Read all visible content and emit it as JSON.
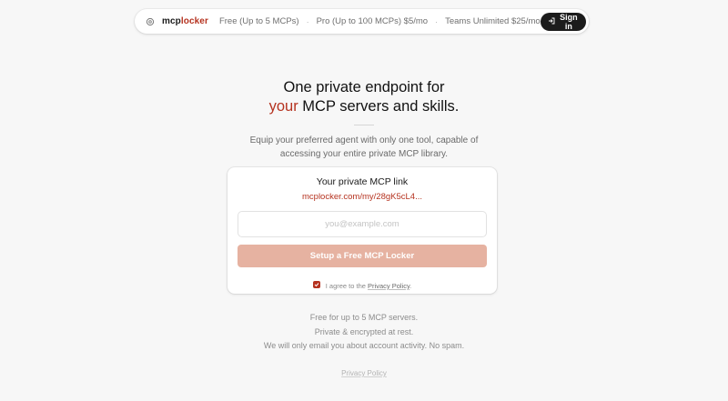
{
  "nav": {
    "logo_mcp": "mcp",
    "logo_locker": "locker",
    "tiers": [
      "Free (Up to 5 MCPs)",
      "Pro (Up to 100 MCPs) $5/mo",
      "Teams Unlimited $25/mo"
    ],
    "signin_label": "Sign in",
    "signin_icon": "login-icon",
    "logo_icon": "gear-icon"
  },
  "hero": {
    "title_line1": "One private endpoint for",
    "title_accent": "your",
    "title_line2_rest": " MCP servers and skills.",
    "subtitle": "Equip your preferred agent with only one tool, capable of accessing your entire private MCP library."
  },
  "card": {
    "title": "Your private MCP link",
    "link": "mcplocker.com/my/28gK5cL4...",
    "email_placeholder": "you@example.com",
    "email_value": "",
    "setup_label": "Setup a Free MCP Locker",
    "agree_prefix": "I agree to the ",
    "agree_link": "Privacy Policy",
    "agree_suffix": ".",
    "agree_checked": true
  },
  "notes": [
    "Free for up to 5 MCP servers.",
    "Private & encrypted at rest.",
    "We will only email you about account activity. No spam."
  ],
  "footer": {
    "privacy_link": "Privacy Policy"
  },
  "colors": {
    "accent": "#b5321f",
    "button_disabled": "#e6b2a1",
    "dark": "#1c1c1c",
    "background": "#f7f7f7"
  }
}
